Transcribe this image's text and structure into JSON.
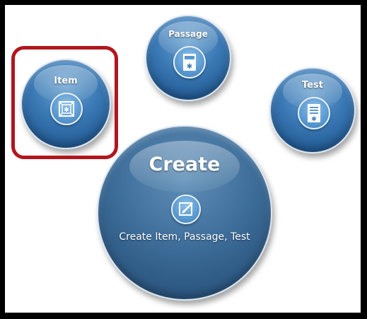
{
  "bubbles": {
    "item": {
      "label": "Item",
      "icon": "cube-icon"
    },
    "passage": {
      "label": "Passage",
      "icon": "passage-doc-icon"
    },
    "test": {
      "label": "Test",
      "icon": "test-doc-icon"
    },
    "create": {
      "title": "Create",
      "subtitle": "Create Item, Passage, Test",
      "icon": "edit-pencil-icon"
    }
  },
  "colors": {
    "bubble_blue": "#3a78b4",
    "create_blue": "#2a557f",
    "highlight_red": "#b2161d"
  }
}
